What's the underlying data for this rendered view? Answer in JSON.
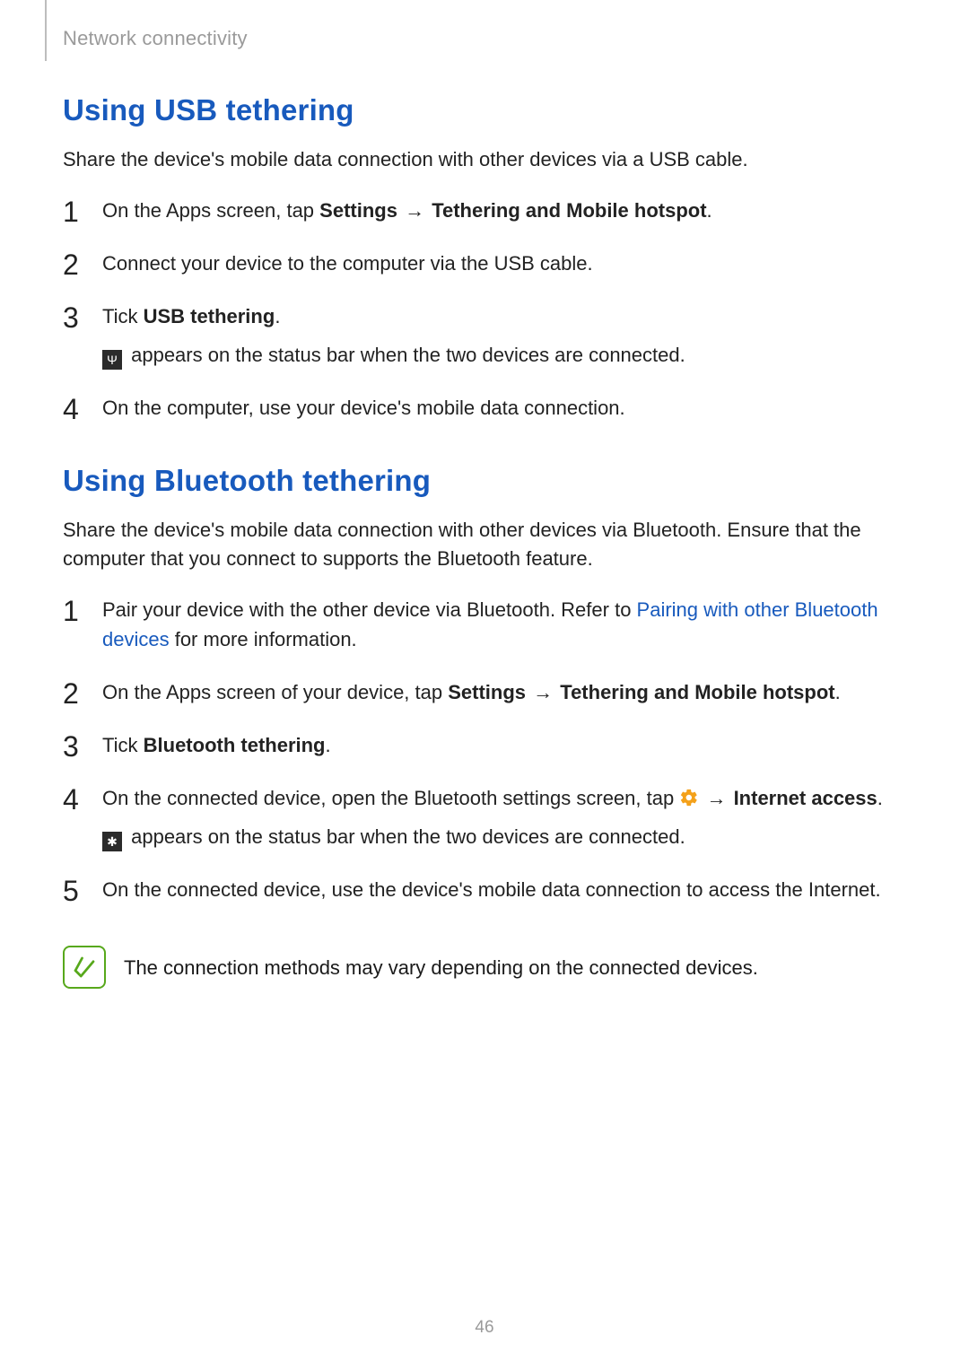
{
  "breadcrumb": "Network connectivity",
  "page_number": "46",
  "icons": {
    "usb_chip": "Ψ",
    "bt_chip": "✱"
  },
  "section_usb": {
    "heading": "Using USB tethering",
    "intro": "Share the device's mobile data connection with other devices via a USB cable.",
    "steps": {
      "s1": {
        "p1": "On the Apps screen, tap ",
        "b1": "Settings",
        "arrow": " → ",
        "b2": "Tethering and Mobile hotspot",
        "tail": "."
      },
      "s2": "Connect your device to the computer via the USB cable.",
      "s3": {
        "p1": "Tick ",
        "b1": "USB tethering",
        "tail": ".",
        "sub": " appears on the status bar when the two devices are connected."
      },
      "s4": "On the computer, use your device's mobile data connection."
    }
  },
  "section_bt": {
    "heading": "Using Bluetooth tethering",
    "intro": "Share the device's mobile data connection with other devices via Bluetooth. Ensure that the computer that you connect to supports the Bluetooth feature.",
    "steps": {
      "s1": {
        "p1": "Pair your device with the other device via Bluetooth. Refer to ",
        "link": "Pairing with other Bluetooth devices",
        "p2": " for more information."
      },
      "s2": {
        "p1": "On the Apps screen of your device, tap ",
        "b1": "Settings",
        "arrow": " → ",
        "b2": "Tethering and Mobile hotspot",
        "tail": "."
      },
      "s3": {
        "p1": "Tick ",
        "b1": "Bluetooth tethering",
        "tail": "."
      },
      "s4": {
        "p1": "On the connected device, open the Bluetooth settings screen, tap ",
        "arrow": " → ",
        "b1": "Internet access",
        "tail": ".",
        "sub": " appears on the status bar when the two devices are connected."
      },
      "s5": "On the connected device, use the device's mobile data connection to access the Internet."
    },
    "note": "The connection methods may vary depending on the connected devices."
  }
}
